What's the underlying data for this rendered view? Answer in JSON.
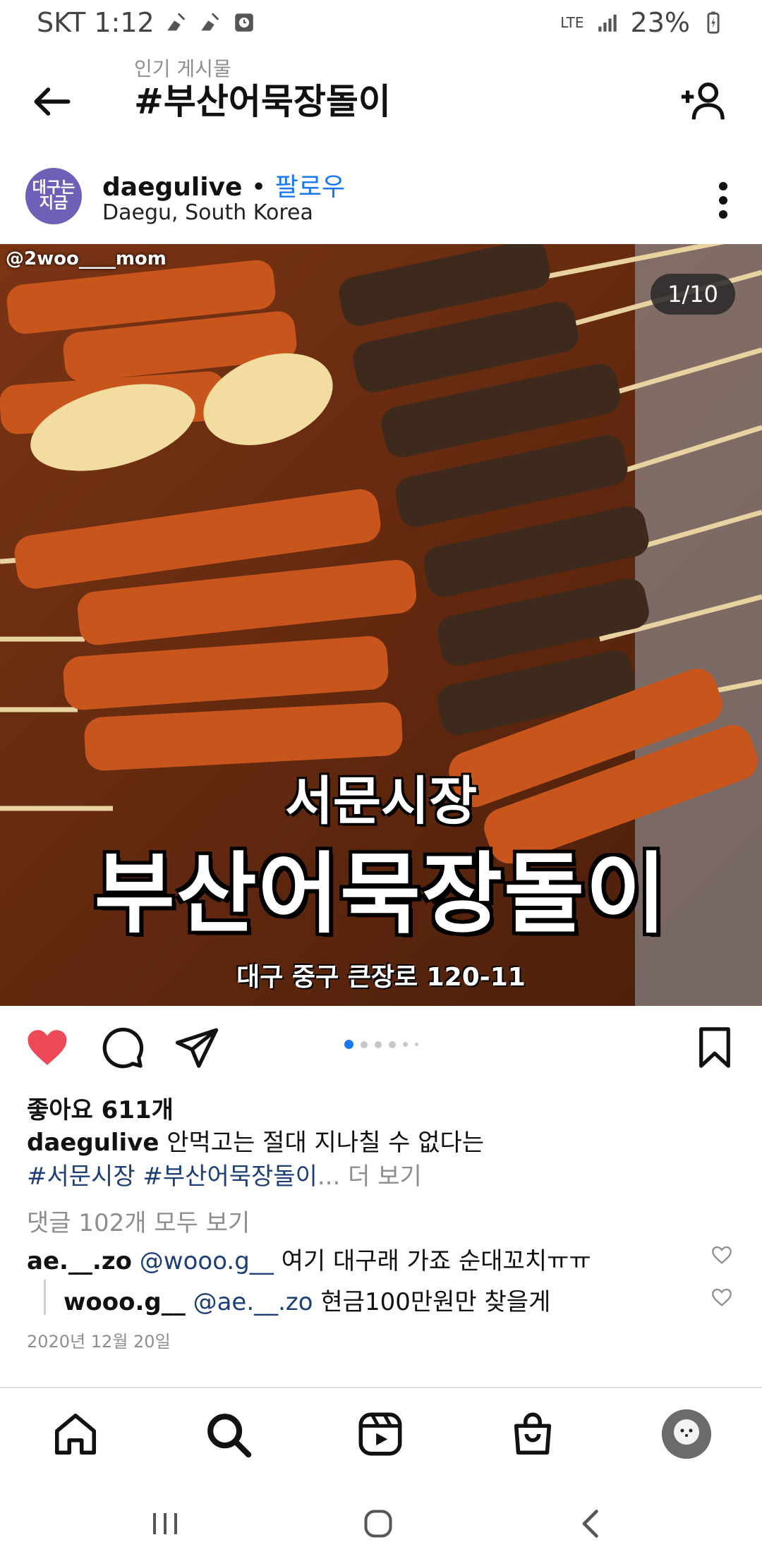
{
  "status_bar": {
    "carrier_time": "SKT 1:12",
    "network": "LTE",
    "battery": "23%"
  },
  "header": {
    "subtitle": "인기 게시물",
    "title": "#부산어묵장돌이"
  },
  "post": {
    "avatar_text": "대구는\n지금",
    "username": "daegulive",
    "separator": "•",
    "follow_label": "팔로우",
    "location": "Daegu, South Korea",
    "image": {
      "counter": "1/10",
      "watermark": "@2woo____mom",
      "subtitle": "서문시장",
      "title": "부산어묵장돌이",
      "address": "대구 중구 큰장로 120-11"
    },
    "likes": "좋아요 611개",
    "caption_user": "daegulive",
    "caption_text": "안먹고는 절대 지나칠 수 없다는",
    "caption_tags": "#서문시장 #부산어묵장돌이",
    "caption_more": "... 더 보기",
    "view_comments": "댓글 102개 모두 보기",
    "comments": [
      {
        "user": "ae.__.zo",
        "mention": "@wooo.g__",
        "text": " 여기 대구래 가죠 순대꼬치ㅠㅠ"
      },
      {
        "user": "wooo.g__",
        "mention": "@ae.__.zo",
        "text": " 현금100만원만 찾을게"
      }
    ],
    "date": "2020년 12월 20일"
  },
  "icons": {
    "back": "arrow-left-icon",
    "add_friend": "add-person-icon",
    "more": "more-vertical-icon",
    "like": "heart-filled-icon",
    "comment": "comment-icon",
    "share": "send-icon",
    "save": "bookmark-icon"
  },
  "colors": {
    "like_red": "#ed4956",
    "link_blue": "#1877f2",
    "tag_blue": "#1d3f77"
  }
}
